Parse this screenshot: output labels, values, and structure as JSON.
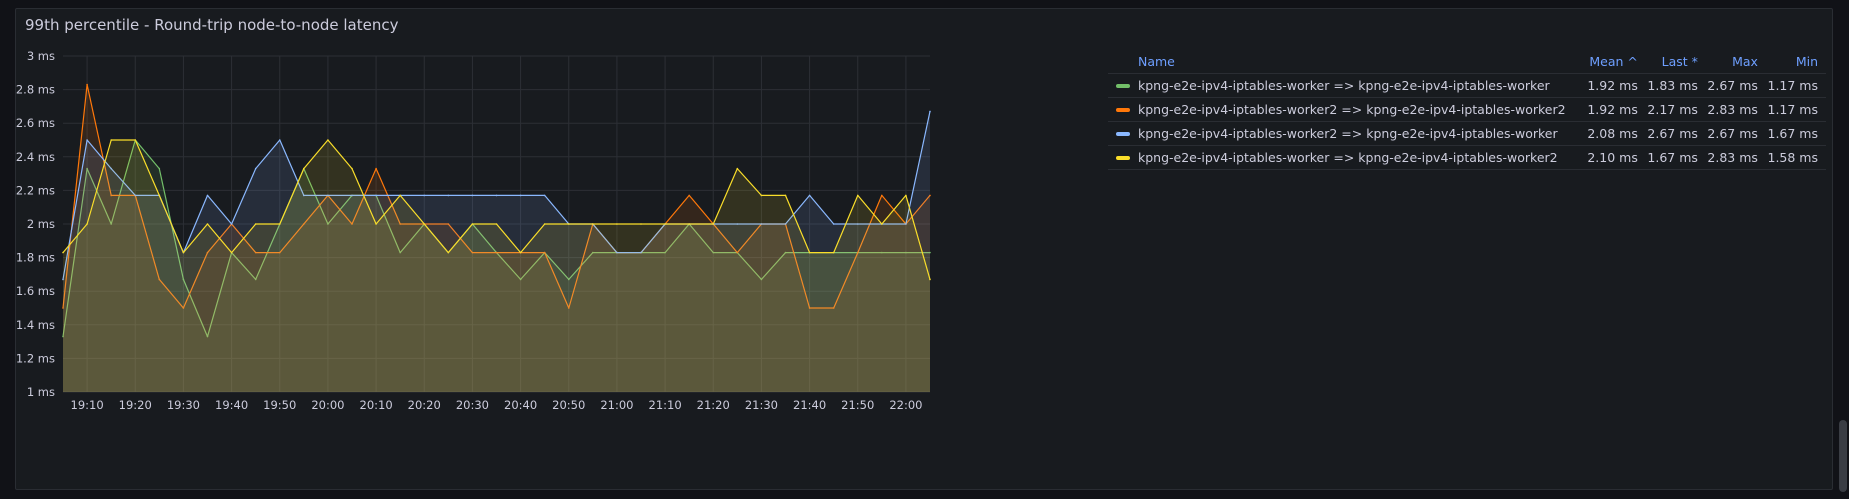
{
  "panel": {
    "title": "99th percentile - Round-trip node-to-node latency"
  },
  "legend": {
    "headers": {
      "name": "Name",
      "mean": "Mean ^",
      "last": "Last *",
      "max": "Max",
      "min": "Min"
    },
    "rows": [
      {
        "name": "kpng-e2e-ipv4-iptables-worker => kpng-e2e-ipv4-iptables-worker",
        "mean": "1.92 ms",
        "last": "1.83 ms",
        "max": "2.67 ms",
        "min": "1.17 ms",
        "color": "#73bf69"
      },
      {
        "name": "kpng-e2e-ipv4-iptables-worker2 => kpng-e2e-ipv4-iptables-worker2",
        "mean": "1.92 ms",
        "last": "2.17 ms",
        "max": "2.83 ms",
        "min": "1.17 ms",
        "color": "#ff780a"
      },
      {
        "name": "kpng-e2e-ipv4-iptables-worker2 => kpng-e2e-ipv4-iptables-worker",
        "mean": "2.08 ms",
        "last": "2.67 ms",
        "max": "2.67 ms",
        "min": "1.67 ms",
        "color": "#8ab8ff"
      },
      {
        "name": "kpng-e2e-ipv4-iptables-worker => kpng-e2e-ipv4-iptables-worker2",
        "mean": "2.10 ms",
        "last": "1.67 ms",
        "max": "2.83 ms",
        "min": "1.58 ms",
        "color": "#fade2a"
      }
    ]
  },
  "chart_data": {
    "type": "line",
    "ylim": [
      1,
      3
    ],
    "yticks": [
      1,
      1.2,
      1.4,
      1.6,
      1.8,
      2,
      2.2,
      2.4,
      2.6,
      2.8,
      3
    ],
    "ytick_labels": [
      "1 ms",
      "1.2 ms",
      "1.4 ms",
      "1.6 ms",
      "1.8 ms",
      "2 ms",
      "2.2 ms",
      "2.4 ms",
      "2.6 ms",
      "2.8 ms",
      "3 ms"
    ],
    "xlim": [
      "19:05",
      "22:05"
    ],
    "xtick_labels": [
      "19:10",
      "19:20",
      "19:30",
      "19:40",
      "19:50",
      "20:00",
      "20:10",
      "20:20",
      "20:30",
      "20:40",
      "20:50",
      "21:00",
      "21:10",
      "21:20",
      "21:30",
      "21:40",
      "21:50",
      "22:00"
    ],
    "grid": true,
    "legend_placement": "right",
    "x": [
      "19:05",
      "19:10",
      "19:15",
      "19:20",
      "19:25",
      "19:30",
      "19:35",
      "19:40",
      "19:45",
      "19:50",
      "19:55",
      "20:00",
      "20:05",
      "20:10",
      "20:15",
      "20:20",
      "20:25",
      "20:30",
      "20:35",
      "20:40",
      "20:45",
      "20:50",
      "20:55",
      "21:00",
      "21:05",
      "21:10",
      "21:15",
      "21:20",
      "21:25",
      "21:30",
      "21:35",
      "21:40",
      "21:45",
      "21:50",
      "21:55",
      "22:00",
      "22:05"
    ],
    "series": [
      {
        "name": "kpng-e2e-ipv4-iptables-worker => kpng-e2e-ipv4-iptables-worker",
        "color": "#73bf69",
        "values": [
          1.33,
          2.33,
          2.0,
          2.5,
          2.33,
          1.67,
          1.33,
          1.83,
          1.67,
          2.0,
          2.33,
          2.0,
          2.17,
          2.17,
          1.83,
          2.0,
          1.83,
          2.0,
          1.83,
          1.67,
          1.83,
          1.67,
          1.83,
          1.83,
          1.83,
          1.83,
          2.0,
          1.83,
          1.83,
          1.67,
          1.83,
          1.83,
          1.83,
          1.83,
          1.83,
          1.83,
          1.83
        ]
      },
      {
        "name": "kpng-e2e-ipv4-iptables-worker2 => kpng-e2e-ipv4-iptables-worker2",
        "color": "#ff780a",
        "values": [
          1.5,
          2.83,
          2.17,
          2.17,
          1.67,
          1.5,
          1.83,
          2.0,
          1.83,
          1.83,
          2.0,
          2.17,
          2.0,
          2.33,
          2.0,
          2.0,
          2.0,
          1.83,
          1.83,
          1.83,
          1.83,
          1.5,
          2.0,
          1.83,
          1.83,
          2.0,
          2.17,
          2.0,
          1.83,
          2.0,
          2.0,
          1.5,
          1.5,
          1.83,
          2.17,
          2.0,
          2.17
        ]
      },
      {
        "name": "kpng-e2e-ipv4-iptables-worker2 => kpng-e2e-ipv4-iptables-worker",
        "color": "#8ab8ff",
        "values": [
          1.67,
          2.5,
          2.33,
          2.17,
          2.17,
          1.83,
          2.17,
          2.0,
          2.33,
          2.5,
          2.17,
          2.17,
          2.17,
          2.17,
          2.17,
          2.17,
          2.17,
          2.17,
          2.17,
          2.17,
          2.17,
          2.0,
          2.0,
          1.83,
          1.83,
          2.0,
          2.0,
          2.0,
          2.0,
          2.0,
          2.0,
          2.17,
          2.0,
          2.0,
          2.0,
          2.0,
          2.67
        ]
      },
      {
        "name": "kpng-e2e-ipv4-iptables-worker => kpng-e2e-ipv4-iptables-worker2",
        "color": "#fade2a",
        "values": [
          1.83,
          2.0,
          2.5,
          2.5,
          2.17,
          1.83,
          2.0,
          1.83,
          2.0,
          2.0,
          2.33,
          2.5,
          2.33,
          2.0,
          2.17,
          2.0,
          1.83,
          2.0,
          2.0,
          1.83,
          2.0,
          2.0,
          2.0,
          2.0,
          2.0,
          2.0,
          2.0,
          2.0,
          2.33,
          2.17,
          2.17,
          1.83,
          1.83,
          2.17,
          2.0,
          2.17,
          1.67
        ]
      }
    ]
  }
}
